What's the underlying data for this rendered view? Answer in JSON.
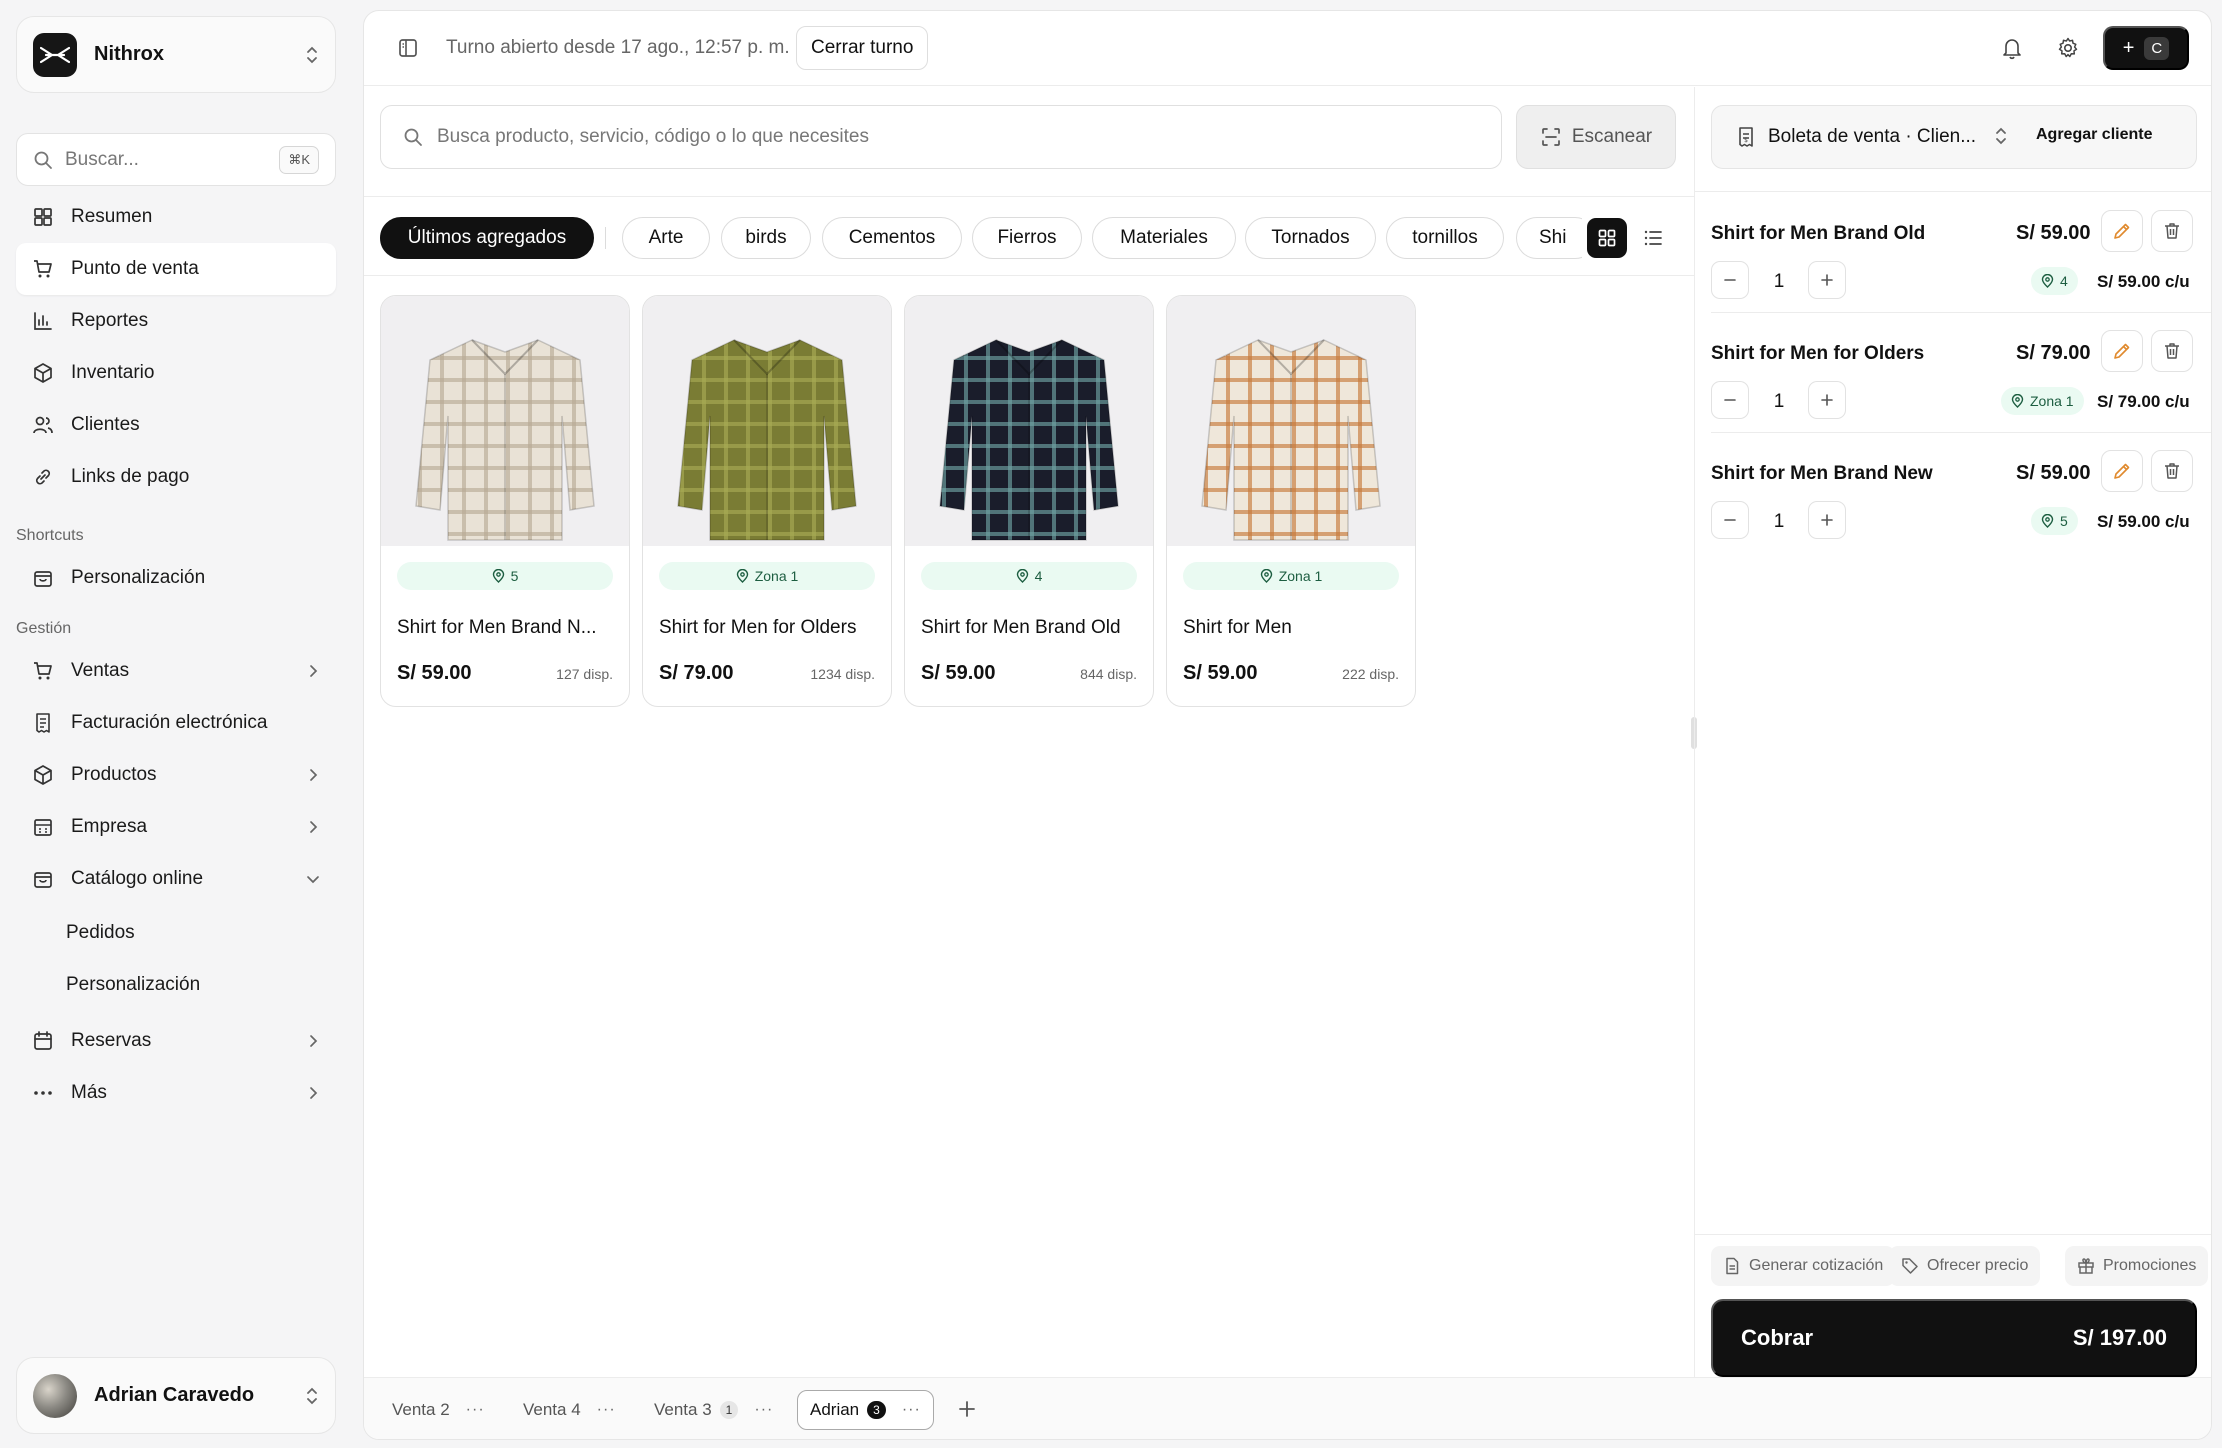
{
  "workspace": {
    "name": "Nithrox"
  },
  "sidebar": {
    "search_placeholder": "Buscar...",
    "search_shortcut": "⌘K",
    "main_items": [
      {
        "label": "Resumen",
        "icon": "dashboard-icon"
      },
      {
        "label": "Punto de venta",
        "icon": "cart-icon",
        "active": true
      },
      {
        "label": "Reportes",
        "icon": "chart-icon"
      },
      {
        "label": "Inventario",
        "icon": "box-icon"
      },
      {
        "label": "Clientes",
        "icon": "users-icon"
      },
      {
        "label": "Links de pago",
        "icon": "link-icon"
      }
    ],
    "shortcuts_title": "Shortcuts",
    "shortcut_items": [
      {
        "label": "Personalización",
        "icon": "store-icon"
      }
    ],
    "gestion_title": "Gestión",
    "gestion_items": [
      {
        "label": "Ventas",
        "icon": "cart-icon",
        "chevron": "right"
      },
      {
        "label": "Facturación electrónica",
        "icon": "receipt-icon"
      },
      {
        "label": "Productos",
        "icon": "box-icon",
        "chevron": "right"
      },
      {
        "label": "Empresa",
        "icon": "building-icon",
        "chevron": "right"
      },
      {
        "label": "Catálogo online",
        "icon": "store-icon",
        "chevron": "down"
      }
    ],
    "catalog_sub": [
      "Pedidos",
      "Personalización"
    ],
    "more_items": [
      {
        "label": "Reservas",
        "icon": "calendar-icon",
        "chevron": "right"
      },
      {
        "label": "Más",
        "icon": "more-icon",
        "chevron": "right"
      }
    ],
    "user": {
      "name": "Adrian Caravedo"
    }
  },
  "topbar": {
    "shift_text": "Turno abierto desde 17 ago., 12:57 p. m.",
    "close_shift": "Cerrar turno",
    "new_plus": "+",
    "new_shortcut": "C"
  },
  "search": {
    "placeholder": "Busca producto, servicio, código o lo que necesites",
    "scan_label": "Escanear"
  },
  "categories": [
    {
      "label": "Últimos agregados",
      "active": true
    },
    {
      "label": "Arte"
    },
    {
      "label": "birds"
    },
    {
      "label": "Cementos"
    },
    {
      "label": "Fierros"
    },
    {
      "label": "Materiales"
    },
    {
      "label": "Tornados"
    },
    {
      "label": "tornillos"
    },
    {
      "label": "Shi"
    }
  ],
  "products": [
    {
      "location": "5",
      "name": "Shirt for Men Brand N...",
      "price": "S/ 59.00",
      "stock": "127 disp.",
      "colors": [
        "#e9e2d6",
        "#b9aa95"
      ]
    },
    {
      "location": "Zona 1",
      "name": "Shirt for Men for Olders",
      "price": "S/ 79.00",
      "stock": "1234 disp.",
      "colors": [
        "#7a7c34",
        "#a8aa55"
      ]
    },
    {
      "location": "4",
      "name": "Shirt for Men Brand Old",
      "price": "S/ 59.00",
      "stock": "844 disp.",
      "colors": [
        "#1a1d2b",
        "#6fa3a3"
      ]
    },
    {
      "location": "Zona 1",
      "name": "Shirt for Men",
      "price": "S/ 59.00",
      "stock": "222 disp.",
      "colors": [
        "#efe7da",
        "#c87a3a"
      ]
    }
  ],
  "sale": {
    "document": "Boleta de venta · Clien...",
    "add_client": "Agregar cliente",
    "items": [
      {
        "name": "Shirt for Men Brand Old",
        "price": "S/ 59.00",
        "qty": "1",
        "zone": "4",
        "unit": "S/ 59.00 c/u"
      },
      {
        "name": "Shirt for Men for Olders",
        "price": "S/ 79.00",
        "qty": "1",
        "zone": "Zona 1",
        "unit": "S/ 79.00 c/u"
      },
      {
        "name": "Shirt for Men Brand New",
        "price": "S/ 59.00",
        "qty": "1",
        "zone": "5",
        "unit": "S/ 59.00 c/u"
      }
    ],
    "actions": [
      "Generar cotización",
      "Ofrecer precio",
      "Promociones"
    ],
    "charge_label": "Cobrar",
    "total": "S/ 197.00"
  },
  "tabs": [
    {
      "label": "Venta 2"
    },
    {
      "label": "Venta 4"
    },
    {
      "label": "Venta 3",
      "count": "1"
    },
    {
      "label": "Adrian",
      "count": "3",
      "active": true
    }
  ],
  "colors": {
    "accent": "#111111",
    "edit": "#e08a2e",
    "zone_bg": "#eafaf2",
    "zone_text": "#1d5e41"
  }
}
